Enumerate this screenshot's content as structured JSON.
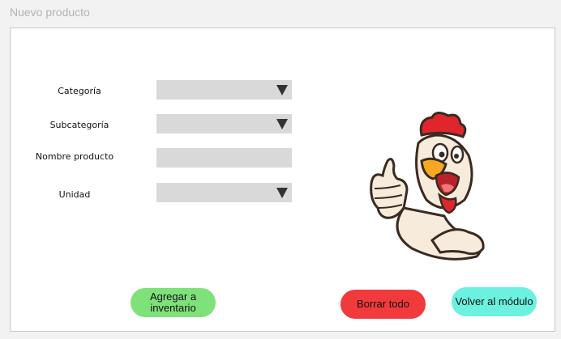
{
  "window": {
    "title": "Nuevo producto"
  },
  "form": {
    "category_label": "Categoría",
    "subcategory_label": "Subcategoría",
    "product_name_label": "Nombre producto",
    "unit_label": "Unidad",
    "category_value": "",
    "subcategory_value": "",
    "product_name_value": "",
    "unit_value": ""
  },
  "buttons": {
    "add_label": "Agregar a inventario",
    "clear_label": "Borrar todo",
    "back_label": "Volver al módulo"
  },
  "colors": {
    "add_button": "#7ee17a",
    "clear_button": "#f13a3c",
    "back_button": "#6cf0df",
    "field_bg": "#d9d9d9"
  },
  "icons": {
    "dropdown": "caret-down-icon",
    "mascot": "chicken-thumbs-up-mascot"
  }
}
